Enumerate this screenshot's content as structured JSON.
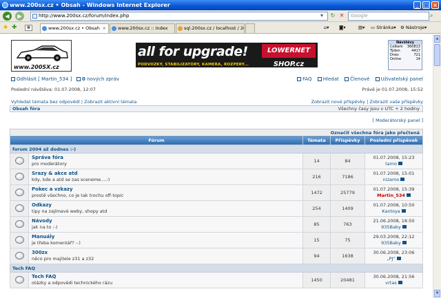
{
  "window": {
    "title": "www.200sx.cz • Obsah - Windows Internet Explorer",
    "min": "_",
    "max": "□",
    "close": "×"
  },
  "address": {
    "url": "http://www.200sx.cz/forum/index.php",
    "search_placeholder": "Google"
  },
  "tabs": [
    {
      "label": "www.200sx.cz • Obsah"
    },
    {
      "label": "www.200sx.cz :: Index"
    },
    {
      "label": "sql.200sx.cz / localhost / 200..."
    }
  ],
  "toolbar": {
    "page": "Stránka",
    "tools": "Nástroje"
  },
  "logo_text": "www.200SX.cz",
  "banner": {
    "main": "all for upgrade!",
    "shop": "LOWERNET SHOP.cz",
    "sub": "PODVOZKY, STABILIZATORY, KAMERA, ROZPERY..."
  },
  "stats": {
    "header": "Návštěvy",
    "rows": [
      {
        "label": "Celkem",
        "value": "360813"
      },
      {
        "label": "Týden",
        "value": "4417"
      },
      {
        "label": "Dnes",
        "value": "721"
      },
      {
        "label": "Online",
        "value": "14"
      }
    ]
  },
  "user": {
    "logout": "Odhlásit [ Martin_534 ]",
    "pm_count": "0",
    "pm_text": "nových zpráv"
  },
  "toplinks": {
    "faq": "FAQ",
    "search": "Hledat",
    "members": "Členové",
    "panel": "Uživatelský panel"
  },
  "last_visit": "Poslední návštěva: 01.07.2008, 12:07",
  "now": "Právě je 01.07.2008, 15:52",
  "search_links": {
    "left": "Vyhledat témata bez odpovědí | Zobrazit aktivní témata",
    "right": "Zobrazit nové příspěvky | Zobrazit vaše příspěvky"
  },
  "breadcrumb": "Obsah fóra",
  "timezone": "Všechny časy jsou v UTC + 2 hodiny",
  "mod_panel": "[ Moderátorský panel ]",
  "mark_read": "Označit všechna fóra jako přečtená",
  "columns": {
    "forum": "Fórum",
    "topics": "Témata",
    "posts": "Příspěvky",
    "last": "Poslední příspěvek"
  },
  "categories": [
    {
      "name": "forum 2004 až dodnes :-)",
      "forums": [
        {
          "name": "Správa fóra",
          "desc": "pro moderátory",
          "topics": "14",
          "posts": "84",
          "date": "01.07.2008, 15:23",
          "user": "tamo",
          "red": false
        },
        {
          "name": "Srazy & akce atd",
          "desc": "kdy, kde a atd se zas sceneme....:)",
          "topics": "216",
          "posts": "7186",
          "date": "01.07.2008, 15:01",
          "user": "nizamo",
          "red": false
        },
        {
          "name": "Pokec a vzkazy",
          "desc": "prostě všechno, co je tak trochu off-topic",
          "topics": "1472",
          "posts": "25779",
          "date": "01.07.2008, 15:39",
          "user": "Martin_534",
          "red": true
        },
        {
          "name": "Odkazy",
          "desc": "tipy na zajímavé weby, shopy atd",
          "topics": "254",
          "posts": "1409",
          "date": "01.07.2008, 10:50",
          "user": "Kantoya",
          "red": false
        },
        {
          "name": "Návody",
          "desc": "jak na to :-)",
          "topics": "85",
          "posts": "763",
          "date": "21.06.2008, 18:50",
          "user": "935Baby",
          "red": false
        },
        {
          "name": "Manuály",
          "desc": "je třeba komentář? :-)",
          "topics": "15",
          "posts": "75",
          "date": "29.03.2008, 22:12",
          "user": "935Baby",
          "red": false
        },
        {
          "name": "300zx",
          "desc": "něco pro majitele z31 a z32",
          "topics": "94",
          "posts": "1638",
          "date": "30.06.2008, 23:06",
          "user": "„PJ“",
          "red": false
        }
      ]
    },
    {
      "name": "Tech FAQ",
      "forums": [
        {
          "name": "Tech FAQ",
          "desc": "otázky a odpovědi technického rázu",
          "topics": "1450",
          "posts": "20481",
          "date": "30.06.2008, 21:56",
          "user": "vrtas",
          "red": false
        }
      ]
    }
  ]
}
